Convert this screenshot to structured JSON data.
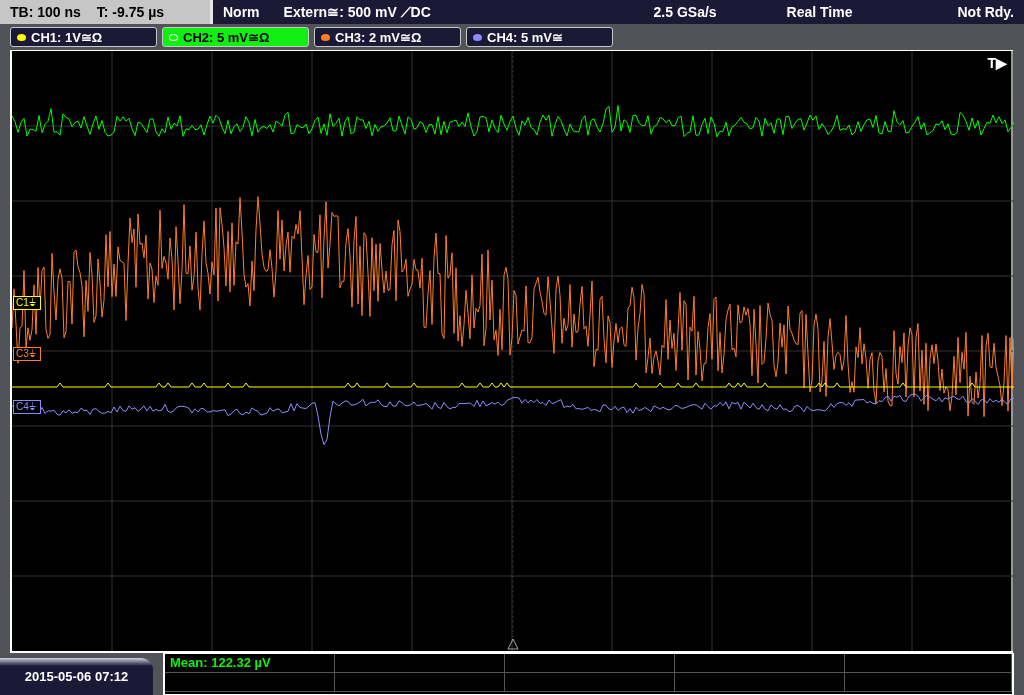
{
  "status_bar": {
    "timebase": "TB: 100 ns",
    "trigger_time": "T: -9.75 µs",
    "trigger_mode": "Norm",
    "trigger_source": "Extern≅: 500 mV ⟋DC",
    "sample_rate": "2.5 GSa/s",
    "acquisition": "Real Time",
    "state": "Not Rdy."
  },
  "channels": [
    {
      "label": "CH1: 1V≅Ω",
      "selected": false,
      "color": "#ffff00"
    },
    {
      "label": "CH2: 5 mV≅Ω",
      "selected": true,
      "color": "#00ff00"
    },
    {
      "label": "CH3: 2 mV≅Ω",
      "selected": false,
      "color": "#ff7f27"
    },
    {
      "label": "CH4: 5 mV≅",
      "selected": false,
      "color": "#8c8cff"
    }
  ],
  "markers": [
    {
      "label": "C1⏚",
      "color": "#ffff00"
    },
    {
      "label": "C3⏚",
      "color": "#ff7f27"
    },
    {
      "label": "C4⏚",
      "color": "#8c8cff"
    }
  ],
  "trigger_label": "T▶",
  "measurement": "Mean: 122.32 µV",
  "date": "2015-05-06 07:12"
}
